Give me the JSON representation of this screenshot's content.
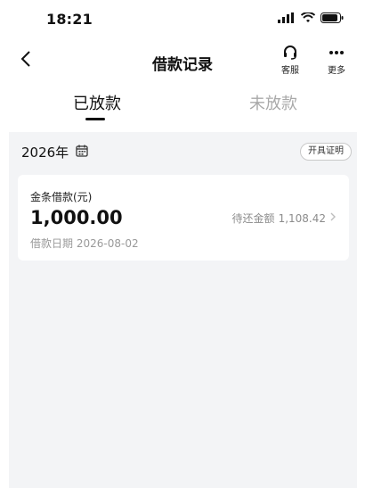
{
  "status_bar": {
    "time": "18:21"
  },
  "nav": {
    "title": "借款记录",
    "back_icon": "chevron-left-icon",
    "service_label": "客服",
    "more_label": "更多"
  },
  "tabs": [
    {
      "label": "已放款",
      "active": true
    },
    {
      "label": "未放款",
      "active": false
    }
  ],
  "filter": {
    "year": "2026年",
    "calendar_icon": "calendar-icon",
    "certificate_button": "开具证明"
  },
  "records": [
    {
      "title": "金条借款(元)",
      "amount": "1,000.00",
      "date_label": "借款日期",
      "date": "2026-08-02",
      "repay_label": "待还金额",
      "repay_amount": "1,108.42"
    }
  ],
  "colors": {
    "active_text": "#111111",
    "inactive_text": "#a9a9a9",
    "background": "#f3f4f6"
  }
}
